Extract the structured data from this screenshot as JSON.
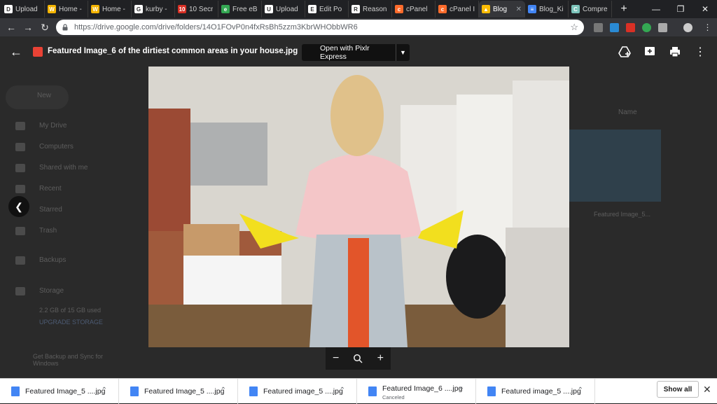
{
  "browser": {
    "tabs": [
      {
        "title": "Upload",
        "fav_color": "#ffffff",
        "fav_letter": "D"
      },
      {
        "title": "Home -",
        "fav_color": "#f4b400",
        "fav_letter": "W"
      },
      {
        "title": "Home -",
        "fav_color": "#f4b400",
        "fav_letter": "W"
      },
      {
        "title": "kurby -",
        "fav_color": "#ffffff",
        "fav_letter": "G"
      },
      {
        "title": "10 Secr",
        "fav_color": "#d93025",
        "fav_letter": "10"
      },
      {
        "title": "Free eB",
        "fav_color": "#34a853",
        "fav_letter": "e"
      },
      {
        "title": "Upload",
        "fav_color": "#ffffff",
        "fav_letter": "U"
      },
      {
        "title": "Edit Po",
        "fav_color": "#ffffff",
        "fav_letter": "E"
      },
      {
        "title": "Reason",
        "fav_color": "#ffffff",
        "fav_letter": "R"
      },
      {
        "title": "cPanel",
        "fav_color": "#ff6c2c",
        "fav_letter": "c"
      },
      {
        "title": "cPanel I",
        "fav_color": "#ff6c2c",
        "fav_letter": "c"
      },
      {
        "title": "Blog",
        "fav_color": "#fbbc04",
        "fav_letter": "▲",
        "active": true
      },
      {
        "title": "Blog_Ki",
        "fav_color": "#4285f4",
        "fav_letter": "≡"
      },
      {
        "title": "Compre",
        "fav_color": "#7cc4bb",
        "fav_letter": "C"
      }
    ],
    "new_tab_label": "+",
    "url": "https://drive.google.com/drive/folders/14O1FOvP0n4fxRsBh5zzm3KbrWHObbWR6"
  },
  "viewer": {
    "file_name": "Featured Image_6 of the dirtiest common areas in your house.jpg",
    "open_with_label": "Open with Pixlr Express",
    "zoom_out": "−",
    "zoom_in": "+",
    "drive_sidebar": [
      "New",
      "My Drive",
      "Computers",
      "Shared with me",
      "Recent",
      "Starred",
      "Trash",
      "Backups",
      "Storage",
      "2.2 GB of 15 GB used",
      "UPGRADE STORAGE",
      "Get Backup and Sync for Windows"
    ],
    "background_file": "Featured Image_5...",
    "name_header": "Name"
  },
  "downloads": {
    "items": [
      {
        "name": "Featured Image_5 ....jpg",
        "status": ""
      },
      {
        "name": "Featured Image_5 ....jpg",
        "status": ""
      },
      {
        "name": "Featured image_5 ....jpg",
        "status": ""
      },
      {
        "name": "Featured Image_6 ....jpg",
        "status": "Canceled"
      },
      {
        "name": "Featured image_5 ....jpg",
        "status": ""
      }
    ],
    "show_all": "Show all"
  }
}
